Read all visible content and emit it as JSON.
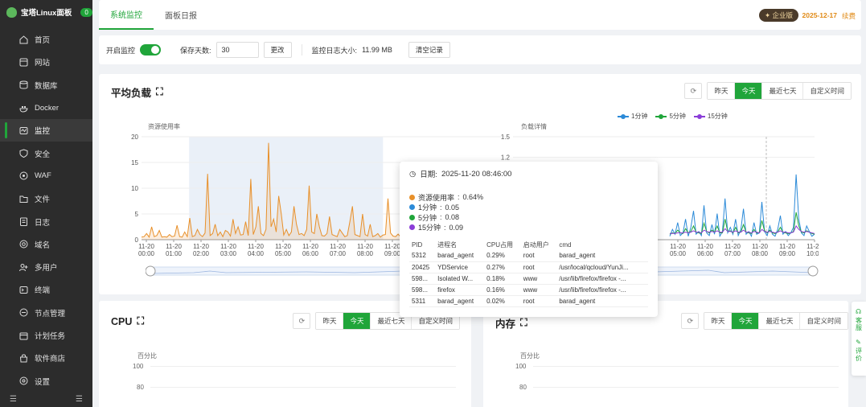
{
  "brand": {
    "name": "宝塔Linux面板",
    "badge": "0"
  },
  "sidebar": {
    "items": [
      {
        "label": "首页",
        "icon": "home-icon"
      },
      {
        "label": "网站",
        "icon": "globe-icon"
      },
      {
        "label": "数据库",
        "icon": "database-icon"
      },
      {
        "label": "Docker",
        "icon": "docker-icon"
      },
      {
        "label": "监控",
        "icon": "monitor-icon",
        "active": true
      },
      {
        "label": "安全",
        "icon": "shield-icon"
      },
      {
        "label": "WAF",
        "icon": "waf-icon"
      },
      {
        "label": "文件",
        "icon": "folder-icon"
      },
      {
        "label": "日志",
        "icon": "log-icon"
      },
      {
        "label": "域名",
        "icon": "domain-icon"
      },
      {
        "label": "多用户",
        "icon": "users-icon"
      },
      {
        "label": "终端",
        "icon": "terminal-icon"
      },
      {
        "label": "节点管理",
        "icon": "node-icon"
      },
      {
        "label": "计划任务",
        "icon": "calendar-icon"
      },
      {
        "label": "软件商店",
        "icon": "store-icon"
      },
      {
        "label": "设置",
        "icon": "settings-icon"
      }
    ],
    "footer": [
      "☰",
      "☰"
    ]
  },
  "topbar": {
    "tabs": [
      "系统监控",
      "面板日报"
    ],
    "edition": "企业版",
    "expire_date": "2025-12-17",
    "renew": "续费"
  },
  "controls": {
    "enable_label": "开启监控",
    "days_label": "保存天数:",
    "days_value": "30",
    "change_btn": "更改",
    "log_size_label": "监控日志大小:",
    "log_size_value": "11.99 MB",
    "clear_btn": "清空记录"
  },
  "load_card": {
    "title": "平均负载",
    "range_buttons": [
      "昨天",
      "今天",
      "最近七天",
      "自定义时间"
    ],
    "active_range": "今天"
  },
  "cpu_card": {
    "title": "CPU",
    "range_buttons": [
      "昨天",
      "今天",
      "最近七天",
      "自定义时间"
    ],
    "y_label": "百分比",
    "y_ticks": [
      "100",
      "80"
    ]
  },
  "mem_card": {
    "title": "内存",
    "range_buttons": [
      "昨天",
      "今天",
      "最近七天",
      "自定义时间"
    ],
    "y_label": "百分比",
    "y_ticks": [
      "100",
      "80"
    ]
  },
  "tooltip": {
    "date_label": "日期:",
    "date_value": "2025-11-20 08:46:00",
    "rows": [
      {
        "label": "资源使用率",
        "value": "0.64%",
        "color": "#e8902a"
      },
      {
        "label": "1分钟",
        "value": "0.05",
        "color": "#2b8ad8"
      },
      {
        "label": "5分钟",
        "value": "0.08",
        "color": "#20a53a"
      },
      {
        "label": "15分钟",
        "value": "0.09",
        "color": "#8a3dd8"
      }
    ],
    "table_headers": [
      "PID",
      "进程名",
      "CPU占用",
      "启动用户",
      "cmd"
    ],
    "table_rows": [
      [
        "5312",
        "barad_agent",
        "0.29%",
        "root",
        "barad_agent"
      ],
      [
        "20425",
        "YDService",
        "0.27%",
        "root",
        "/usr/local/qcloud/YunJi..."
      ],
      [
        "598...",
        "Isolated W...",
        "0.18%",
        "www",
        "/usr/lib/firefox/firefox -..."
      ],
      [
        "598...",
        "firefox",
        "0.16%",
        "www",
        "/usr/lib/firefox/firefox -..."
      ],
      [
        "5311",
        "barad_agent",
        "0.02%",
        "root",
        "barad_agent"
      ]
    ]
  },
  "float_side": {
    "service": "客服",
    "review": "评价"
  },
  "chart_data": [
    {
      "type": "line",
      "title": "",
      "ylabel": "资源使用率",
      "ylim": [
        0,
        20
      ],
      "y_ticks": [
        0,
        5,
        10,
        15,
        20
      ],
      "x_ticks": [
        "11-20\n00:00",
        "11-20\n01:00",
        "11-20\n02:00",
        "11-20\n03:00",
        "11-20\n04:00",
        "11-20\n05:00",
        "11-20\n06:00",
        "11-20\n07:00",
        "11-20\n08:00",
        "11-20\n09:00"
      ],
      "series": [
        {
          "name": "资源使用率",
          "color": "#e8902a",
          "values": [
            0.5,
            0.6,
            1.2,
            0.5,
            2.5,
            0.6,
            0.8,
            1.8,
            0.5,
            0.6,
            0.5,
            1.0,
            0.6,
            0.7,
            2.8,
            0.6,
            0.5,
            1.5,
            0.6,
            4.2,
            0.6,
            0.8,
            2.0,
            1.0,
            0.6,
            1.3,
            12.8,
            0.8,
            1.2,
            3.0,
            0.8,
            1.5,
            0.6,
            1.8,
            1.5,
            0.7,
            4.0,
            1.2,
            2.5,
            0.9,
            1.0,
            3.5,
            0.8,
            11.8,
            1.0,
            2.5,
            6.5,
            1.2,
            0.8,
            2.0,
            18.8,
            2.5,
            4.0,
            1.5,
            8.5,
            5.0,
            0.9,
            2.0,
            0.8,
            1.5,
            6.5,
            3.0,
            1.0,
            1.2,
            0.8,
            2.0,
            10.5,
            1.5,
            1.2,
            5.0,
            2.5,
            0.8,
            0.7,
            1.2,
            4.5,
            1.0,
            0.8,
            0.6,
            2.0,
            1.3,
            0.6,
            0.8,
            3.5,
            6.5,
            1.0,
            0.8,
            0.6,
            5.0,
            1.0,
            0.7,
            3.0,
            0.6,
            0.8,
            1.2,
            0.5,
            0.9,
            1.0,
            8.0,
            1.3,
            0.7,
            0.6,
            1.1,
            0.5,
            2.0,
            0.8,
            0.6,
            1.5,
            0.7,
            0.6,
            9.0,
            1.0,
            3.0,
            0.6,
            0.5,
            0.8,
            1.2,
            0.6,
            5.0,
            1.5,
            0.8,
            0.6,
            1.0,
            4.5,
            0.8,
            0.9,
            0.6,
            1.2,
            0.8,
            10.5,
            5.5,
            1.0,
            2.5,
            0.8,
            1.2,
            0.6,
            4.0,
            0.6,
            0.8,
            0.5,
            1.0,
            1.5,
            0.6,
            1.5,
            0.7,
            0.6
          ]
        }
      ]
    },
    {
      "type": "line",
      "title": "",
      "ylabel": "负载详情",
      "ylim": [
        0,
        1.5
      ],
      "y_ticks": [
        1.5,
        1.2
      ],
      "x_ticks": [
        "11-20\n05:00",
        "11-20\n06:00",
        "11-20\n07:00",
        "11-20\n08:00",
        "11-20\n09:00",
        "11-20\n10:00"
      ],
      "series": [
        {
          "name": "1分钟",
          "color": "#2b8ad8",
          "values": [
            0.05,
            0.15,
            0.08,
            0.25,
            0.06,
            0.1,
            0.3,
            0.05,
            0.18,
            0.42,
            0.08,
            0.12,
            0.06,
            0.5,
            0.1,
            0.06,
            0.22,
            0.08,
            0.38,
            0.05,
            0.12,
            0.6,
            0.1,
            0.18,
            0.08,
            0.3,
            0.06,
            0.15,
            0.45,
            0.08,
            0.12,
            0.05,
            0.25,
            0.08,
            0.1,
            0.55,
            0.12,
            0.06,
            0.2,
            0.08,
            0.05,
            0.15,
            0.35,
            0.08,
            0.12,
            0.06,
            0.1,
            0.18,
            0.95,
            0.3,
            0.1,
            0.06,
            0.2,
            0.12,
            0.05,
            0.08
          ]
        },
        {
          "name": "5分钟",
          "color": "#20a53a",
          "values": [
            0.08,
            0.1,
            0.09,
            0.14,
            0.1,
            0.09,
            0.16,
            0.1,
            0.12,
            0.2,
            0.11,
            0.1,
            0.09,
            0.24,
            0.12,
            0.1,
            0.14,
            0.11,
            0.2,
            0.1,
            0.1,
            0.3,
            0.12,
            0.13,
            0.1,
            0.18,
            0.1,
            0.11,
            0.22,
            0.11,
            0.1,
            0.09,
            0.15,
            0.1,
            0.1,
            0.28,
            0.13,
            0.1,
            0.14,
            0.1,
            0.09,
            0.11,
            0.18,
            0.11,
            0.1,
            0.09,
            0.1,
            0.12,
            0.4,
            0.2,
            0.11,
            0.1,
            0.13,
            0.11,
            0.09,
            0.08
          ]
        },
        {
          "name": "15分钟",
          "color": "#8a3dd8",
          "values": [
            0.09,
            0.09,
            0.09,
            0.1,
            0.1,
            0.1,
            0.11,
            0.1,
            0.11,
            0.13,
            0.11,
            0.11,
            0.1,
            0.14,
            0.12,
            0.11,
            0.12,
            0.11,
            0.13,
            0.11,
            0.11,
            0.16,
            0.12,
            0.12,
            0.11,
            0.13,
            0.11,
            0.11,
            0.14,
            0.11,
            0.11,
            0.1,
            0.12,
            0.11,
            0.1,
            0.15,
            0.12,
            0.11,
            0.12,
            0.11,
            0.1,
            0.11,
            0.13,
            0.11,
            0.11,
            0.1,
            0.1,
            0.11,
            0.2,
            0.15,
            0.12,
            0.11,
            0.12,
            0.11,
            0.1,
            0.09
          ]
        }
      ]
    }
  ]
}
